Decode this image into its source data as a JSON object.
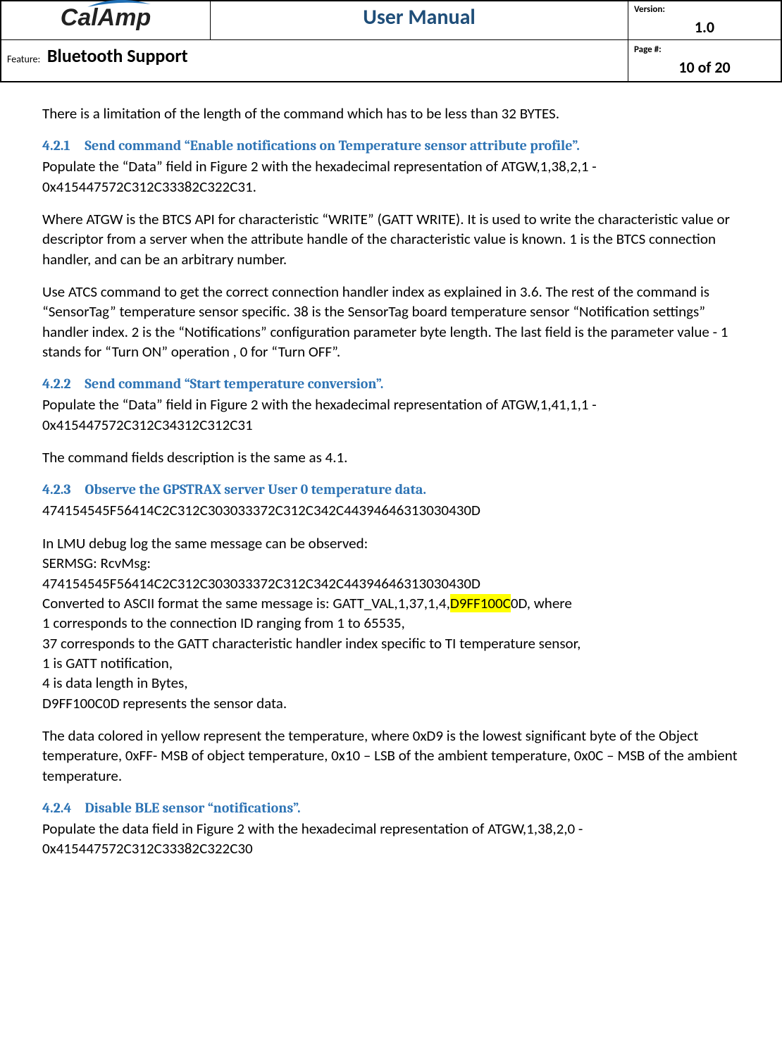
{
  "header": {
    "logo_text": "CalAmp",
    "title": "User Manual",
    "version_label": "Version:",
    "version_value": "1.0",
    "feature_label": "Feature:",
    "feature_value": "Bluetooth Support",
    "page_label": "Page #:",
    "page_value": "10 of 20"
  },
  "body": {
    "intro": "There is a limitation of the length of the command which has to be less than 32 BYTES.",
    "s421_num": "4.2.1",
    "s421_title": "Send command “Enable notifications on Temperature sensor attribute profile”.",
    "s421_p1": "Populate the “Data” field in Figure 2 with the hexadecimal representation of ATGW,1,38,2,1 - 0x415447572C312C33382C322C31.",
    "s421_p2": " Where ATGW is the BTCS  API for  characteristic “WRITE” (GATT WRITE). It is used to write the characteristic value or descriptor from a server when the attribute handle of the characteristic value is known. 1 is the BTCS  connection handler, and can be an arbitrary number.",
    "s421_p3": "Use ATCS command to get the correct connection handler index as explained in 3.6. The rest of the command is “SensorTag” temperature sensor specific.  38 is the SensorTag board temperature sensor “Notification settings” handler index. 2 is the “Notifications” configuration parameter byte length. The last field is the parameter value - 1 stands for “Turn ON” operation , 0 for “Turn OFF”.",
    "s422_num": "4.2.2",
    "s422_title": "Send command “Start temperature conversion”.",
    "s422_p1": "Populate the “Data” field in Figure 2 with the hexadecimal representation of ATGW,1,41,1,1 - 0x415447572C312C34312C312C31",
    "s422_p2": "The command fields description is the same as 4.1.",
    "s423_num": "4.2.3",
    "s423_title": "Observe the GPSTRAX server User 0 temperature data.",
    "s423_hex1": "474154545F56414C2C312C303033372C312C342C44394646313030430D",
    "s423_l1": "In LMU debug log the same message can be observed:",
    "s423_l2": "SERMSG: RcvMsg:",
    "s423_l3": "474154545F56414C2C312C303033372C312C342C44394646313030430D",
    "s423_l4_pre": "Converted to ASCII format the same message is:   GATT_VAL,1,37,1,4,",
    "s423_l4_hl": "D9FF100C",
    "s423_l4_post": "0D, where",
    "s423_l5": "1 corresponds to the connection ID ranging from 1 to 65535,",
    "s423_l6": "37 corresponds to the GATT characteristic handler index specific to TI temperature sensor,",
    "s423_l7": "1 is  GATT notification,",
    "s423_l8": "4 is  data length in Bytes,",
    "s423_l9": "D9FF100C0D  represents the sensor data.",
    "s423_p2": "The data colored in yellow represent the temperature, where 0xD9 is the lowest significant byte of the Object temperature, 0xFF- MSB of object temperature, 0x10 – LSB of the ambient temperature, 0x0C – MSB of the ambient temperature.",
    "s424_num": "4.2.4",
    "s424_title": "Disable BLE sensor “notifications”.",
    "s424_p1": "Populate the data field in Figure 2 with the hexadecimal representation of  ATGW,1,38,2,0 - 0x415447572C312C33382C322C30"
  }
}
